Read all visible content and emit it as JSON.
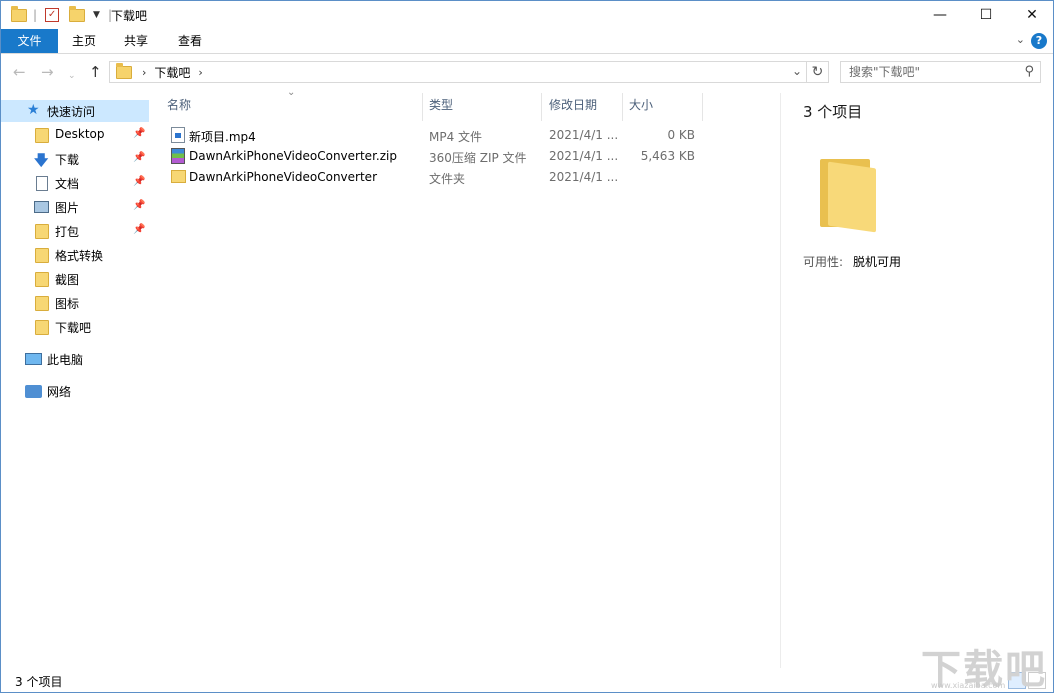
{
  "window": {
    "title": "下载吧",
    "controls": {
      "minimize": "—",
      "maximize": "☐",
      "close": "✕"
    }
  },
  "ribbon": {
    "tabs": [
      "文件",
      "主页",
      "共享",
      "查看"
    ],
    "help": "?"
  },
  "address": {
    "path": [
      "下载吧"
    ],
    "search_placeholder": "搜索\"下载吧\""
  },
  "sidebar": {
    "quick_access": "快速访问",
    "items": [
      {
        "label": "Desktop",
        "icon": "folder-icon",
        "pinned": true
      },
      {
        "label": "下载",
        "icon": "download-arrow-icon",
        "pinned": true
      },
      {
        "label": "文档",
        "icon": "document-icon",
        "pinned": true
      },
      {
        "label": "图片",
        "icon": "picture-icon",
        "pinned": true
      },
      {
        "label": "打包",
        "icon": "folder-icon",
        "pinned": true
      },
      {
        "label": "格式转换",
        "icon": "folder-icon",
        "pinned": false
      },
      {
        "label": "截图",
        "icon": "folder-icon",
        "pinned": false
      },
      {
        "label": "图标",
        "icon": "folder-icon",
        "pinned": false
      },
      {
        "label": "下载吧",
        "icon": "folder-icon",
        "pinned": false
      }
    ],
    "this_pc": "此电脑",
    "network": "网络"
  },
  "columns": {
    "name": "名称",
    "type": "类型",
    "modified": "修改日期",
    "size": "大小"
  },
  "files": [
    {
      "name": "新项目.mp4",
      "type": "MP4 文件",
      "modified": "2021/4/1 ...",
      "size": "0 KB",
      "icon": "video-file-icon"
    },
    {
      "name": "DawnArkiPhoneVideoConverter.zip",
      "type": "360压缩 ZIP 文件",
      "modified": "2021/4/1 ...",
      "size": "5,463 KB",
      "icon": "zip-archive-icon"
    },
    {
      "name": "DawnArkiPhoneVideoConverter",
      "type": "文件夹",
      "modified": "2021/4/1 ...",
      "size": "",
      "icon": "folder-icon"
    }
  ],
  "preview": {
    "count": "3 个项目",
    "availability_label": "可用性:",
    "availability_value": "脱机可用"
  },
  "status": {
    "count": "3 个项目"
  },
  "watermark": {
    "text": "下载吧",
    "sub": "www.xiazaiba.com"
  }
}
